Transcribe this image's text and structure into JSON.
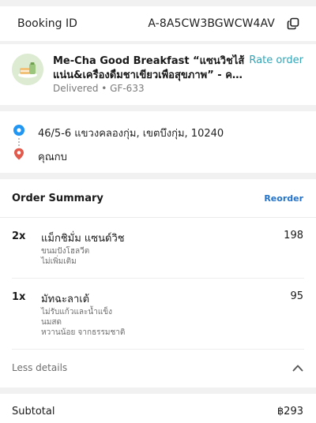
{
  "booking": {
    "label": "Booking ID",
    "id": "A-8A5CW3BGWCW4AV"
  },
  "merchant": {
    "name_line1": "Me-Cha Good Breakfast “แซนวิชไส้",
    "name_line2": "แน่น&เครื่องดื่มชาเขียวเพื่อสุขภาพ” - คลองกุ่ม",
    "status": "Delivered • GF-633",
    "rate_label": "Rate order"
  },
  "addresses": {
    "pickup": "46/5-6 แขวงคลองกุ่ม, เขตบึงกุ่ม, 10240",
    "dropoff": "คุณกบ"
  },
  "order_summary": {
    "title": "Order Summary",
    "reorder_label": "Reorder",
    "items": [
      {
        "qty": "2x",
        "name": "แม็กชิมั่ม แซนด์วิช",
        "price": "198",
        "options": [
          "ขนมปังโฮลวีต",
          "ไม่เพิ่มเติม"
        ]
      },
      {
        "qty": "1x",
        "name": "มัทฉะลาเต้",
        "price": "95",
        "options": [
          "ไม่รับแก้วและน้ำแข็ง",
          "นมสด",
          "หวานน้อย จากธรรมชาติ"
        ]
      }
    ],
    "less_details_label": "Less details"
  },
  "subtotal": {
    "label": "Subtotal",
    "value": "฿293"
  },
  "icons": {
    "copy": "copy-icon",
    "pickup": "pickup-pin-icon",
    "dropoff": "dropoff-pin-icon",
    "collapse": "chevron-up-icon"
  },
  "colors": {
    "accent_teal": "#2ea6b8",
    "link_blue": "#2373c8",
    "pickup_blue": "#2196f3",
    "dropoff_red": "#e25a4c"
  }
}
